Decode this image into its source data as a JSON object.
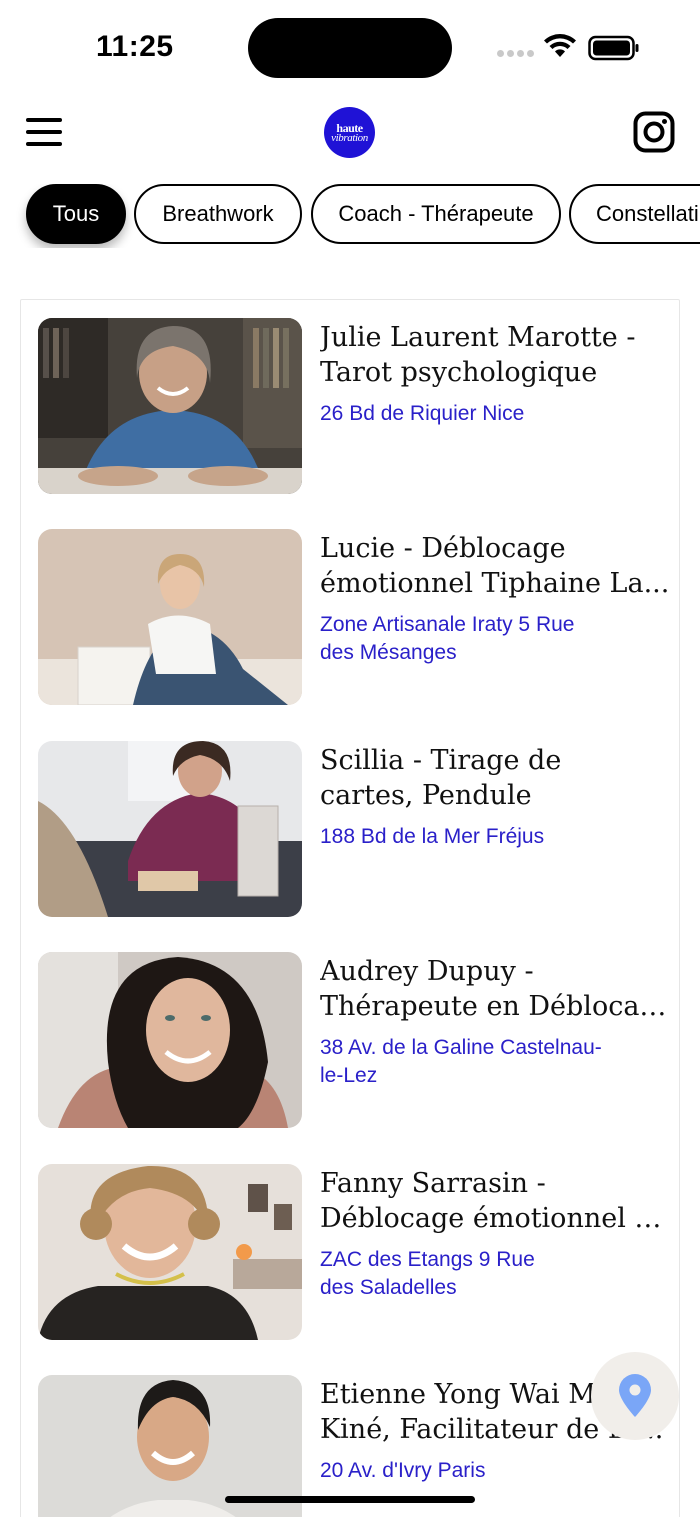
{
  "status_bar": {
    "time": "11:25"
  },
  "header": {
    "logo_line1": "haute",
    "logo_line2": "vibration",
    "brand_color": "#1f12d6",
    "icons": [
      "menu-icon",
      "instagram-icon"
    ]
  },
  "categories": [
    {
      "label": "Tous",
      "selected": true
    },
    {
      "label": "Breathwork",
      "selected": false
    },
    {
      "label": "Coach - Thérapeute",
      "selected": false
    },
    {
      "label": "Constellati",
      "selected": false
    }
  ],
  "listings": [
    {
      "name_line1": "Julie Laurent Marotte -",
      "name_line2": "Tarot psychologique",
      "address_line1": "26 Bd de Riquier Nice",
      "address_line2": ""
    },
    {
      "name_line1": "Lucie - Déblocage",
      "name_line2": "émotionnel Tiphaine La...",
      "address_line1": "Zone Artisanale Iraty 5 Rue",
      "address_line2": "des Mésanges"
    },
    {
      "name_line1": "Scillia - Tirage de",
      "name_line2": "cartes, Pendule",
      "address_line1": "188 Bd de la Mer Fréjus",
      "address_line2": ""
    },
    {
      "name_line1": "Audrey Dupuy  -",
      "name_line2": "Thérapeute en Déblocag...",
      "address_line1": "38 Av. de la Galine Castelnau-",
      "address_line2": "le-Lez"
    },
    {
      "name_line1": "Fanny Sarrasin -",
      "name_line2": "Déblocage émotionnel T...",
      "address_line1": "ZAC des Etangs 9 Rue",
      "address_line2": "des Saladelles"
    },
    {
      "name_line1": "Etienne Yong Wai Ma",
      "name_line2": "Kiné, Facilitateur de Br...",
      "address_line1": "20 Av. d'Ivry Paris",
      "address_line2": ""
    }
  ],
  "colors": {
    "address": "#2a20c9",
    "chip_active_bg": "#000000",
    "fab_bg": "#f1eeea",
    "pin": "#7aa6f7"
  },
  "fab": {
    "icon": "location-pin-icon"
  }
}
